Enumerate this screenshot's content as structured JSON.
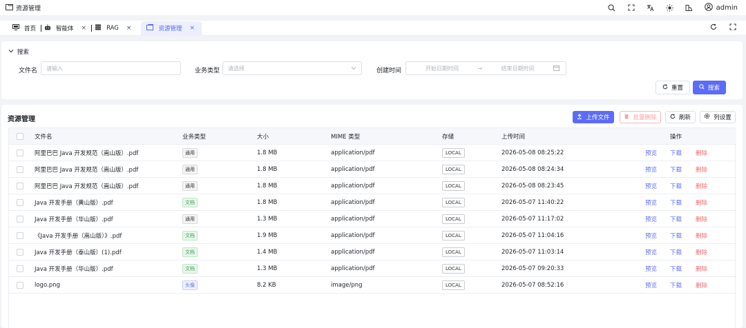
{
  "app": {
    "title": "资源管理",
    "user": "admin"
  },
  "tabs": [
    {
      "label": "首页",
      "closable": false
    },
    {
      "label": "智能体",
      "closable": true
    },
    {
      "label": "RAG",
      "closable": true
    },
    {
      "label": "资源管理",
      "closable": true,
      "active": true
    }
  ],
  "search": {
    "title": "搜索",
    "filename_label": "文件名",
    "filename_placeholder": "请输入",
    "biz_label": "业务类型",
    "biz_placeholder": "请选择",
    "created_label": "创建时间",
    "start_placeholder": "开始日期时间",
    "end_placeholder": "结束日期时间",
    "range_sep": "→",
    "reset_label": "重置",
    "search_label": "搜索"
  },
  "table": {
    "title": "资源管理",
    "upload_label": "上传文件",
    "batch_delete_label": "批量删除",
    "refresh_label": "刷新",
    "columns_label": "列设置",
    "headers": [
      "文件名",
      "业务类型",
      "大小",
      "MIME 类型",
      "存储",
      "上传时间",
      "操作"
    ],
    "actions": {
      "preview": "预览",
      "download": "下载",
      "delete": "删除"
    },
    "rows": [
      {
        "name": "阿里巴巴 Java 开发规范（嵩山版）.pdf",
        "biz": "通用",
        "biz_style": "gray",
        "size": "1.8 MB",
        "mime": "application/pdf",
        "storage": "LOCAL",
        "time": "2026-05-08 08:25:22"
      },
      {
        "name": "阿里巴巴 Java 开发规范（嵩山版）.pdf",
        "biz": "通用",
        "biz_style": "gray",
        "size": "1.8 MB",
        "mime": "application/pdf",
        "storage": "LOCAL",
        "time": "2026-05-08 08:24:34"
      },
      {
        "name": "阿里巴巴 Java 开发规范（嵩山版）.pdf",
        "biz": "通用",
        "biz_style": "gray",
        "size": "1.8 MB",
        "mime": "application/pdf",
        "storage": "LOCAL",
        "time": "2026-05-08 08:23:45"
      },
      {
        "name": "Java 开发手册（黄山版）.pdf",
        "biz": "文档",
        "biz_style": "green",
        "size": "1.8 MB",
        "mime": "application/pdf",
        "storage": "LOCAL",
        "time": "2026-05-07 11:40:22"
      },
      {
        "name": "Java 开发手册（华山版）.pdf",
        "biz": "通用",
        "biz_style": "gray",
        "size": "1.3 MB",
        "mime": "application/pdf",
        "storage": "LOCAL",
        "time": "2026-05-07 11:17:02"
      },
      {
        "name": "《Java 开发手册（嵩山版）》.pdf",
        "biz": "文档",
        "biz_style": "green",
        "size": "1.9 MB",
        "mime": "application/pdf",
        "storage": "LOCAL",
        "time": "2026-05-07 11:04:16"
      },
      {
        "name": "Java 开发手册（泰山版）(1).pdf",
        "biz": "文档",
        "biz_style": "green",
        "size": "1.4 MB",
        "mime": "application/pdf",
        "storage": "LOCAL",
        "time": "2026-05-07 11:03:14"
      },
      {
        "name": "Java 开发手册（华山版）.pdf",
        "biz": "文档",
        "biz_style": "green",
        "size": "1.3 MB",
        "mime": "application/pdf",
        "storage": "LOCAL",
        "time": "2026-05-07 09:20:33"
      },
      {
        "name": "logo.png",
        "biz": "头像",
        "biz_style": "blue",
        "size": "8.2 KB",
        "mime": "image/png",
        "storage": "LOCAL",
        "time": "2026-05-07 08:52:16"
      }
    ]
  }
}
